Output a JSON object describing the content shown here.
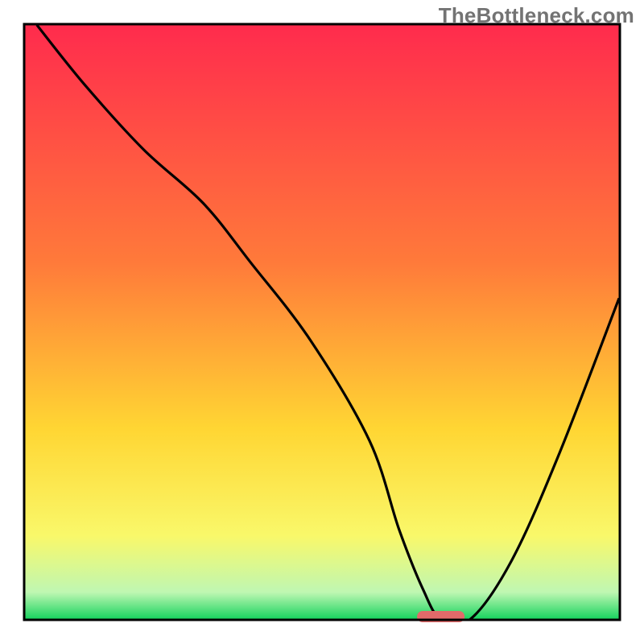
{
  "watermark": "TheBottleneck.com",
  "colors": {
    "top": "#ff2b4d",
    "mid_upper": "#ff7a3a",
    "mid": "#ffd633",
    "mid_lower": "#f9f86a",
    "mint": "#bff7b2",
    "green": "#18d35f",
    "curve": "#000000",
    "marker": "#e26a6a",
    "frame": "#000000"
  },
  "chart_data": {
    "type": "line",
    "title": "",
    "xlabel": "",
    "ylabel": "",
    "xlim": [
      0,
      100
    ],
    "ylim": [
      0,
      100
    ],
    "x": [
      2,
      10,
      20,
      30,
      38,
      48,
      58,
      63,
      67,
      70,
      75,
      82,
      90,
      100
    ],
    "values": [
      100,
      90,
      79,
      70,
      60,
      47,
      30,
      15,
      5,
      0,
      0,
      10,
      28,
      54
    ],
    "marker": {
      "x_start": 66,
      "x_end": 74,
      "y": 0
    }
  }
}
